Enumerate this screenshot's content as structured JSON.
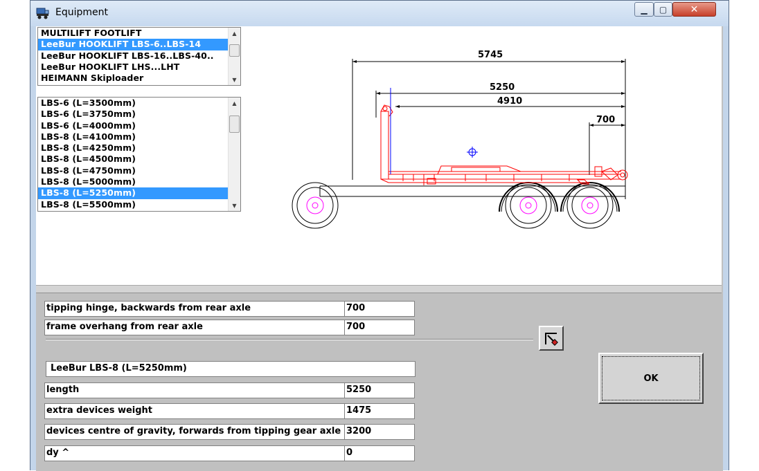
{
  "window": {
    "title": "Equipment",
    "controls": {
      "minimize": "▁",
      "maximize": "▢",
      "close": "✕"
    }
  },
  "equipment_list": {
    "items": [
      {
        "label": "MULTILIFT FOOTLIFT",
        "selected": false
      },
      {
        "label": "LeeBur HOOKLIFT  LBS-6..LBS-14",
        "selected": true
      },
      {
        "label": "LeeBur HOOKLIFT  LBS-16..LBS-40..",
        "selected": false
      },
      {
        "label": "LeeBur HOOKLIFT  LHS...LHT",
        "selected": false
      },
      {
        "label": "HEIMANN Skiploader",
        "selected": false
      }
    ]
  },
  "model_list": {
    "items": [
      {
        "label": "LBS-6 (L=3500mm)",
        "selected": false
      },
      {
        "label": "LBS-6 (L=3750mm)",
        "selected": false
      },
      {
        "label": "LBS-6 (L=4000mm)",
        "selected": false
      },
      {
        "label": "LBS-8 (L=4100mm)",
        "selected": false
      },
      {
        "label": "LBS-8 (L=4250mm)",
        "selected": false
      },
      {
        "label": "LBS-8 (L=4500mm)",
        "selected": false
      },
      {
        "label": "LBS-8 (L=4750mm)",
        "selected": false
      },
      {
        "label": "LBS-8 (L=5000mm)",
        "selected": false
      },
      {
        "label": "LBS-8 (L=5250mm)",
        "selected": true
      },
      {
        "label": "LBS-8 (L=5500mm)",
        "selected": false
      }
    ]
  },
  "drawing": {
    "dimensions": {
      "overall": "5745",
      "length": "5250",
      "inner": "4910",
      "overhang": "700"
    },
    "colors": {
      "chassis": "#000000",
      "equipment": "#ff0000",
      "hub": "#ff00ff",
      "cog_marker": "#0000ff"
    }
  },
  "form": {
    "tipping_hinge": {
      "label": "tipping hinge, backwards from rear axle",
      "value": "700"
    },
    "frame_overhang": {
      "label": "frame overhang from rear axle",
      "value": "700"
    },
    "selected_name": "LeeBur   LBS-8 (L=5250mm)",
    "length": {
      "label": "length",
      "value": "5250"
    },
    "extra_weight": {
      "label": "extra devices weight",
      "value": "1475"
    },
    "centre_gravity": {
      "label": "devices centre of gravity, forwards from tipping gear axle",
      "value": "3200"
    },
    "dy": {
      "label": "dy ^",
      "value": "0"
    }
  },
  "buttons": {
    "ok": "OK"
  }
}
